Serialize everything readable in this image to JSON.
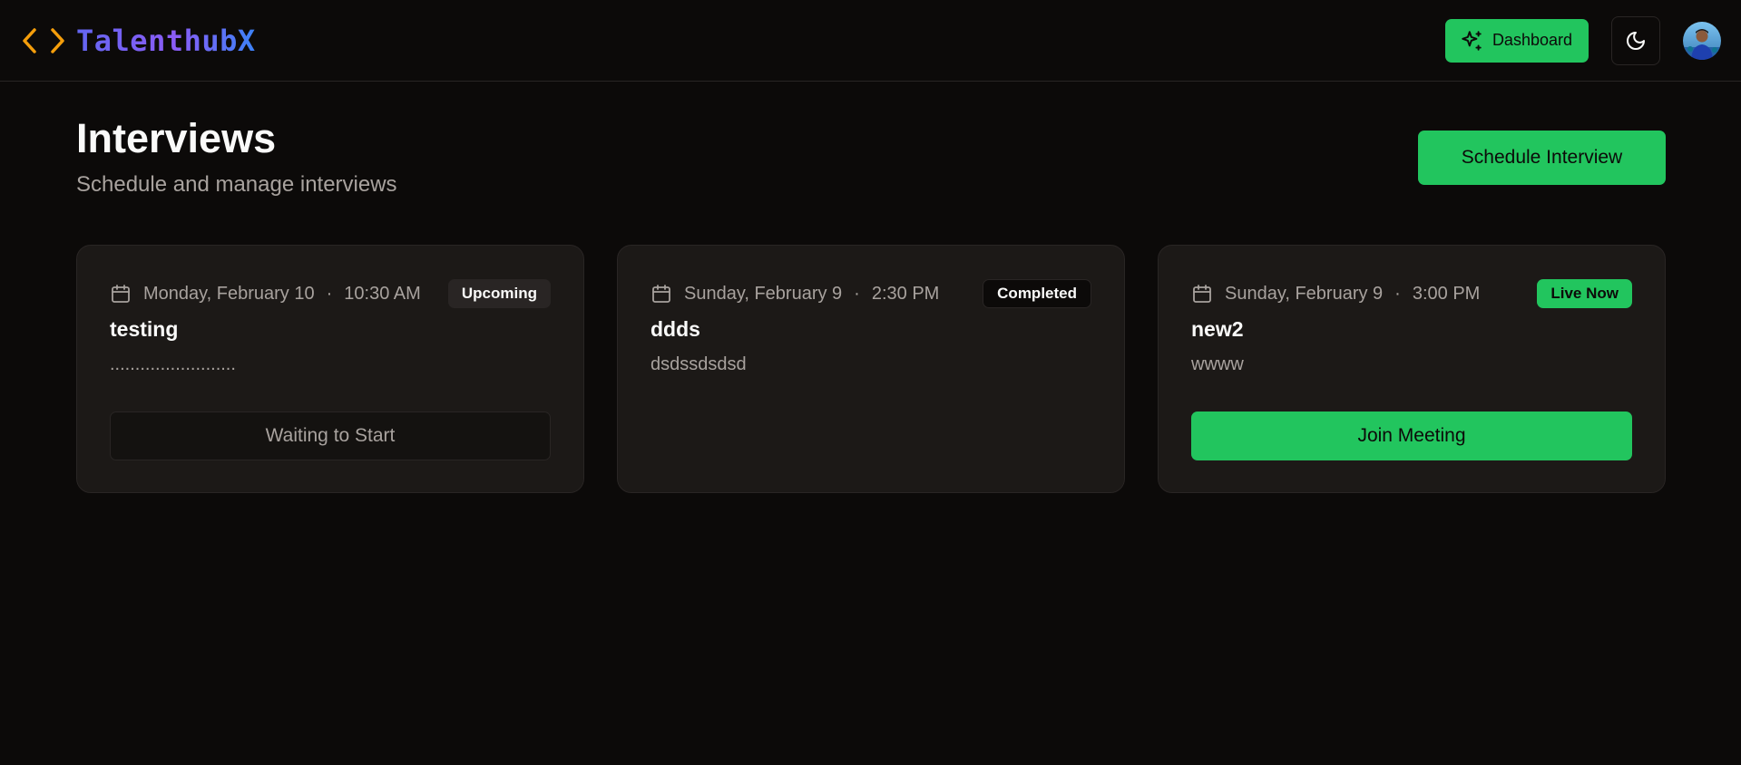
{
  "header": {
    "brand_name": "TalenthubX",
    "brand_icon": "code-brackets-icon",
    "dashboard_label": "Dashboard",
    "dashboard_icon": "sparkles-icon",
    "theme_icon": "moon-icon",
    "avatar_icon": "user-avatar"
  },
  "page": {
    "title": "Interviews",
    "subtitle": "Schedule and manage interviews",
    "schedule_label": "Schedule Interview"
  },
  "cards": [
    {
      "date": "Monday, February 10",
      "time": "10:30 AM",
      "status": "Upcoming",
      "title": "testing",
      "description": ".........................",
      "action": "Waiting to Start"
    },
    {
      "date": "Sunday, February 9",
      "time": "2:30 PM",
      "status": "Completed",
      "title": "ddds",
      "description": "dsdssdsdsd",
      "action": ""
    },
    {
      "date": "Sunday, February 9",
      "time": "3:00 PM",
      "status": "Live Now",
      "title": "new2",
      "description": "wwww",
      "action": "Join Meeting"
    }
  ],
  "separator": "·",
  "colors": {
    "accent_green": "#22c55e",
    "background": "#0c0a09",
    "card_bg": "#1c1917",
    "muted_text": "#a8a29e",
    "brand_orange": "#f59e0b"
  }
}
